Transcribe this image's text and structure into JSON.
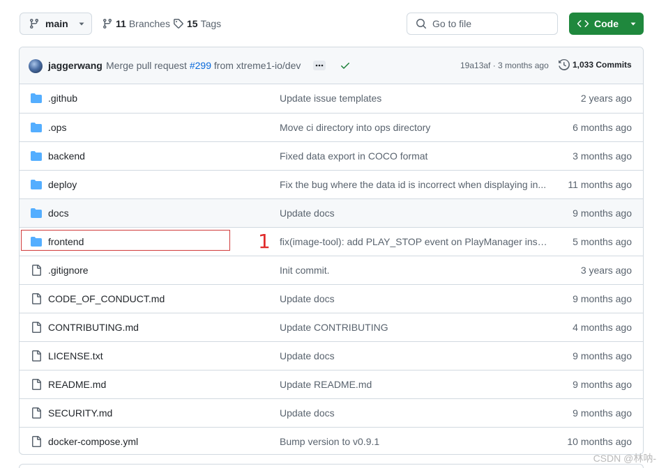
{
  "toolbar": {
    "branch": "main",
    "branches_count": "11",
    "branches_label": "Branches",
    "tags_count": "15",
    "tags_label": "Tags",
    "search_placeholder": "Go to file",
    "code_label": "Code"
  },
  "commit": {
    "author": "jaggerwang",
    "message_prefix": "Merge pull request",
    "pr": "#299",
    "message_suffix": "from xtreme1-io/dev",
    "sha_time": "19a13af · 3 months ago",
    "commits_label": "1,033 Commits"
  },
  "files": [
    {
      "type": "folder",
      "name": ".github",
      "message": "Update issue templates",
      "age": "2 years ago"
    },
    {
      "type": "folder",
      "name": ".ops",
      "message": "Move ci directory into ops directory",
      "age": "6 months ago"
    },
    {
      "type": "folder",
      "name": "backend",
      "message": "Fixed data export in COCO format",
      "age": "3 months ago"
    },
    {
      "type": "folder",
      "name": "deploy",
      "message": "Fix the bug where the data id is incorrect when displaying in...",
      "age": "11 months ago"
    },
    {
      "type": "folder",
      "name": "docs",
      "message": "Update docs",
      "age": "9 months ago"
    },
    {
      "type": "folder",
      "name": "frontend",
      "message": "fix(image-tool): add PLAY_STOP event on PlayManager insta...",
      "age": "5 months ago"
    },
    {
      "type": "file",
      "name": ".gitignore",
      "message": "Init commit.",
      "age": "3 years ago"
    },
    {
      "type": "file",
      "name": "CODE_OF_CONDUCT.md",
      "message": "Update docs",
      "age": "9 months ago"
    },
    {
      "type": "file",
      "name": "CONTRIBUTING.md",
      "message": "Update CONTRIBUTING",
      "age": "4 months ago"
    },
    {
      "type": "file",
      "name": "LICENSE.txt",
      "message": "Update docs",
      "age": "9 months ago"
    },
    {
      "type": "file",
      "name": "README.md",
      "message": "Update README.md",
      "age": "9 months ago"
    },
    {
      "type": "file",
      "name": "SECURITY.md",
      "message": "Update docs",
      "age": "9 months ago"
    },
    {
      "type": "file",
      "name": "docker-compose.yml",
      "message": "Bump version to v0.9.1",
      "age": "10 months ago"
    }
  ],
  "annotation": {
    "label": "1",
    "color": "#e02a2a"
  },
  "watermark": "CSDN @林呐-",
  "colors": {
    "folder": "#54aeff",
    "accent_green": "#1f883d",
    "link": "#0969da",
    "check": "#1a7f37"
  }
}
